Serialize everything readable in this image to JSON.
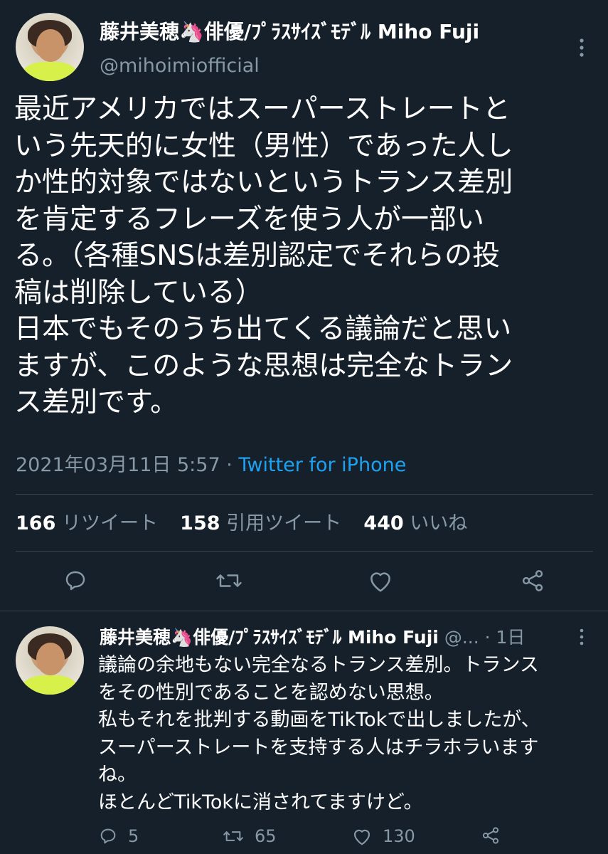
{
  "main_tweet": {
    "display_name": "藤井美穂🦄俳優/ﾌﾟﾗｽｻｲｽﾞﾓﾃﾞﾙ Miho Fuji",
    "handle": "@mihoimiofficial",
    "text": "最近アメリカではスーパーストレートと\nいう先天的に女性（男性）であった人し\nか性的対象ではないというトランス差別\nを肯定するフレーズを使う人が一部い\nる。（各種SNSは差別認定でそれらの投\n稿は削除している）\n日本でもそのうち出てくる議論だと思い\nますが、このような思想は完全なトラン\nス差別です。",
    "timestamp": "2021年03月11日 5:57",
    "separator": " · ",
    "source": "Twitter for iPhone",
    "stats": {
      "retweets_count": "166",
      "retweets_label": "リツイート",
      "quotes_count": "158",
      "quotes_label": "引用ツイート",
      "likes_count": "440",
      "likes_label": "いいね"
    }
  },
  "reply_tweet": {
    "display_name": "藤井美穂🦄俳優/ﾌﾟﾗｽｻｲｽﾞﾓﾃﾞﾙ Miho Fuji",
    "handle_truncated": "@...",
    "time_separator": " · ",
    "time_ago": "1日",
    "text": "議論の余地もない完全なるトランス差別。トランス\nをその性別であることを認めない思想。\n私もそれを批判する動画をTikTokで出しましたが、\nスーパーストレートを支持する人はチラホラいます\nね。\nほとんどTikTokに消されてますけど。",
    "reply_count": "5",
    "retweet_count": "65",
    "like_count": "130"
  },
  "colors": {
    "background": "#15202b",
    "text": "#ffffff",
    "secondary": "#8899a6",
    "link": "#1da1f2",
    "divider": "#38444d"
  },
  "icons": {
    "more": "more-vertical-icon",
    "reply": "reply-icon",
    "retweet": "retweet-icon",
    "like": "heart-icon",
    "share": "share-icon"
  }
}
